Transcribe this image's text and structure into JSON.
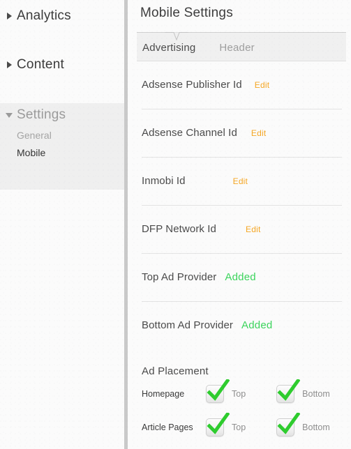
{
  "colors": {
    "edit_link": "#f5a623",
    "added_status": "#3bd45c",
    "selected_nav": "#333333",
    "divider": "#c9c9c9",
    "checkbox_tick": "#2ecc2e"
  },
  "sidebar": {
    "sections": [
      {
        "label": "Analytics",
        "caret": "triangle-right-icon",
        "expanded": false,
        "items": []
      },
      {
        "label": "Content",
        "caret": "triangle-right-icon",
        "expanded": false,
        "items": []
      },
      {
        "label": "Settings",
        "caret": "triangle-down-icon",
        "expanded": true,
        "items": [
          {
            "label": "General",
            "selected": false
          },
          {
            "label": "Mobile",
            "selected": true
          }
        ]
      }
    ]
  },
  "main": {
    "title": "Mobile Settings",
    "tabs": [
      {
        "label": "Advertising",
        "active": true
      },
      {
        "label": "Header",
        "active": false
      }
    ],
    "settings_rows": [
      {
        "label": "Adsense Publisher Id",
        "action": "Edit",
        "action_type": "edit"
      },
      {
        "label": "Adsense Channel Id",
        "action": "Edit",
        "action_type": "edit"
      },
      {
        "label": "Inmobi Id",
        "action": "Edit",
        "action_type": "edit"
      },
      {
        "label": "DFP Network Id",
        "action": "Edit",
        "action_type": "edit"
      },
      {
        "label": "Top Ad Provider",
        "action": "Added",
        "action_type": "added"
      },
      {
        "label": "Bottom Ad Provider",
        "action": "Added",
        "action_type": "added"
      }
    ],
    "ad_placement": {
      "title": "Ad Placement",
      "rows": [
        {
          "label": "Homepage",
          "options": [
            {
              "label": "Top",
              "checked": true
            },
            {
              "label": "Bottom",
              "checked": true
            }
          ]
        },
        {
          "label": "Article Pages",
          "options": [
            {
              "label": "Top",
              "checked": true
            },
            {
              "label": "Bottom",
              "checked": true
            }
          ]
        }
      ]
    }
  }
}
